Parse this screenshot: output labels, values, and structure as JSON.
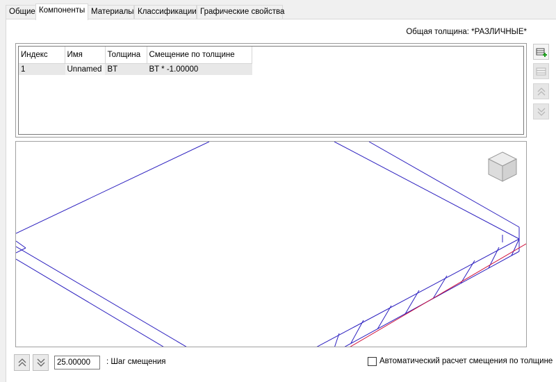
{
  "tabs": [
    {
      "label": "Общие"
    },
    {
      "label": "Компоненты",
      "active": true
    },
    {
      "label": "Материалы"
    },
    {
      "label": "Классификации"
    },
    {
      "label": "Графические свойства"
    }
  ],
  "total_thickness": "Общая толщина: *РАЗЛИЧНЫЕ*",
  "grid": {
    "headers": [
      "Индекс",
      "Имя",
      "Толщина",
      "Смещение по толщине"
    ],
    "rows": [
      {
        "index": "1",
        "name": "Unnamed",
        "thickness": "BT",
        "offset": "BT * -1.00000"
      }
    ]
  },
  "side_buttons": [
    {
      "icon": "add-component-icon",
      "enabled": true
    },
    {
      "icon": "remove-component-icon",
      "enabled": false
    },
    {
      "icon": "move-up-icon",
      "enabled": false
    },
    {
      "icon": "move-down-icon",
      "enabled": false
    }
  ],
  "viewcube": {
    "icon": "view-cube-icon"
  },
  "bottom": {
    "step_value": "25.00000",
    "step_label": ": Шаг смещения",
    "auto_label": "Автоматический расчет смещения по толщине",
    "auto_checked": false
  },
  "colors": {
    "edge": "#2b1fbf",
    "highlight": "#d0103a"
  }
}
